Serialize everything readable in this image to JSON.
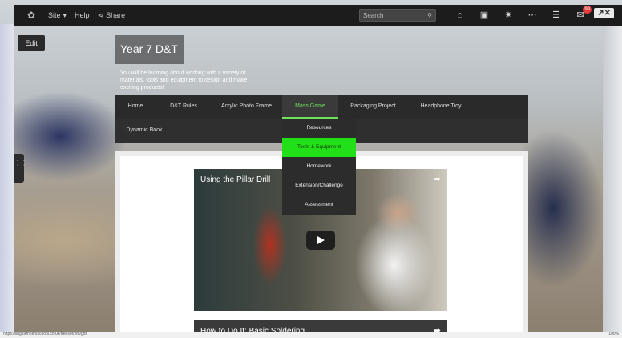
{
  "topbar": {
    "site_label": "Site",
    "help_label": "Help",
    "share_label": "Share",
    "search_placeholder": "Search",
    "notification_count": "99"
  },
  "edit_label": "Edit",
  "header": {
    "title": "Year 7 D&T",
    "description": "You will be learning about working with a variety of materials, tools and equipment to design and make exciting products!"
  },
  "nav": {
    "row1": [
      "Home",
      "D&T Rules",
      "Acrylic Photo Frame",
      "Mass Game",
      "Packaging Project",
      "Headphone Tidy"
    ],
    "row2": [
      "Dynamic Book"
    ],
    "active_index": 3
  },
  "dropdown": {
    "items": [
      "Resources",
      "Tools & Equipment",
      "Homework",
      "Extension/Challenge",
      "Assessment"
    ],
    "highlighted_index": 1
  },
  "videos": [
    {
      "title": "Using the Pillar Drill"
    },
    {
      "title": "How to Do It: Basic Soldering"
    }
  ],
  "statusbar": {
    "url": "https://ling.brmhersschool.co.uk/freesor/pm/gdf",
    "zoom": "100%"
  }
}
